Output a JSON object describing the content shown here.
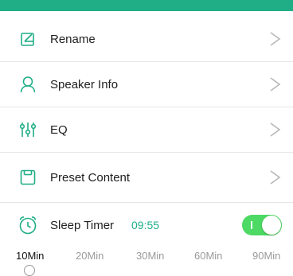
{
  "colors": {
    "accent": "#1fae86",
    "toggle_on": "#4cd964",
    "chevron": "#b8b8b8"
  },
  "menu": [
    {
      "label": "Rename",
      "icon": "edit-icon"
    },
    {
      "label": "Speaker Info",
      "icon": "user-icon"
    },
    {
      "label": "EQ",
      "icon": "equalizer-icon"
    },
    {
      "label": "Preset Content",
      "icon": "preset-icon"
    }
  ],
  "sleep_timer": {
    "label": "Sleep Timer",
    "time": "09:55",
    "icon": "alarm-clock-icon",
    "enabled": true,
    "options": [
      "10Min",
      "20Min",
      "30Min",
      "60Min",
      "90Min"
    ],
    "selected": "10Min"
  }
}
